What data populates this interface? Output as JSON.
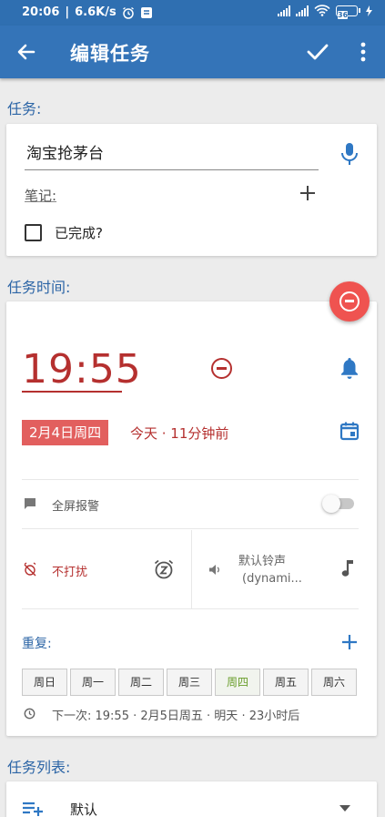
{
  "status_bar": {
    "time": "20:06",
    "net_speed": "6.6K/s",
    "battery": "36"
  },
  "app_bar": {
    "title": "编辑任务",
    "icons": [
      "arrow-back-icon",
      "check-icon",
      "more-vert-icon"
    ]
  },
  "task_section": {
    "label": "任务:",
    "task_name": "淘宝抢茅台",
    "notes_label": "笔记:",
    "completed_label": "已完成?",
    "completed": false
  },
  "time_section": {
    "label": "任务时间:",
    "time": "19:55",
    "date": "2月4日周四",
    "relative": "今天 · 11分钟前",
    "fullscreen_label": "全屏报警",
    "fullscreen_on": false,
    "dnd_label": "不打扰",
    "ringtone_line1": "默认铃声",
    "ringtone_line2": "(dynami...",
    "repeat_label": "重复:",
    "days": [
      "周日",
      "周一",
      "周二",
      "周三",
      "周四",
      "周五",
      "周六"
    ],
    "highlight_day": "周四",
    "next_occurrence": "下一次: 19:55 · 2月5日周五 · 明天 · 23小时后"
  },
  "list_section": {
    "label": "任务列表:",
    "selected": "默认"
  },
  "colors": {
    "primary": "#3474b8",
    "statusbar": "#2f6fb1",
    "overdue_red": "#b5302f",
    "chip_red": "#e25f5e",
    "fab_red": "#ef5350",
    "section_blue": "#2c65a6",
    "today_green": "#6a9e2c"
  }
}
